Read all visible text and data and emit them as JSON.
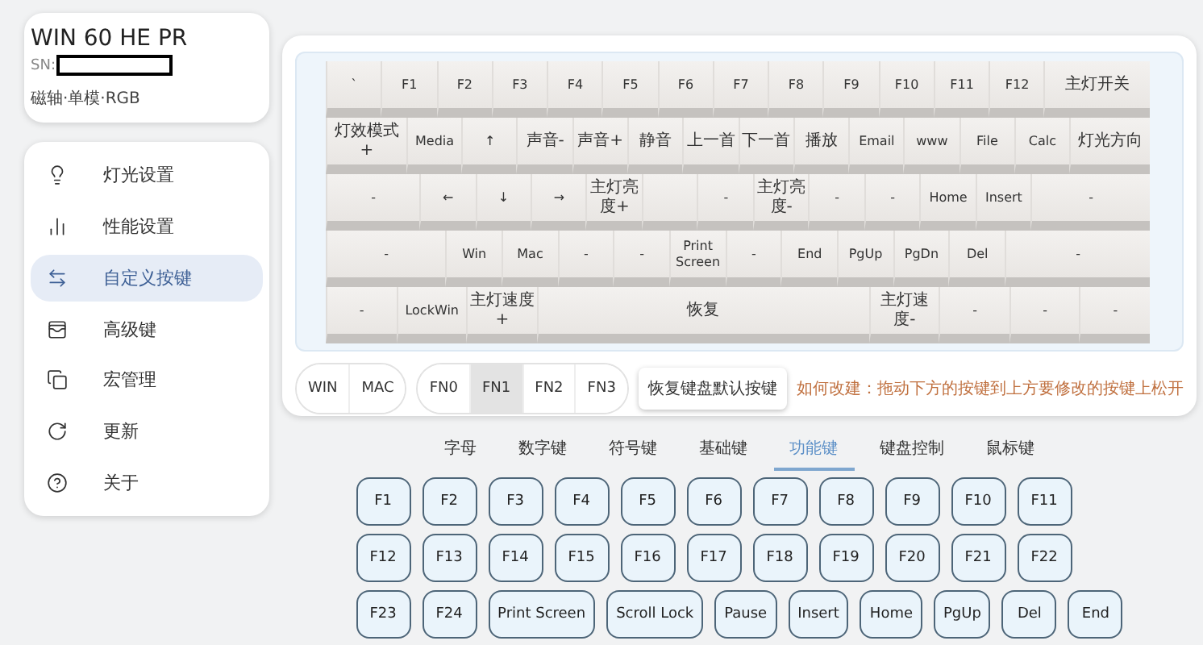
{
  "device": {
    "name": "WIN 60 HE PR",
    "sn_label": "SN:",
    "sn_redacted": true,
    "spec": "磁轴·单模·RGB"
  },
  "sidebar": {
    "items": [
      {
        "label": "灯光设置",
        "selected": false
      },
      {
        "label": "性能设置",
        "selected": false
      },
      {
        "label": "自定义按键",
        "selected": true
      },
      {
        "label": "高级键",
        "selected": false
      },
      {
        "label": "宏管理",
        "selected": false
      },
      {
        "label": "更新",
        "selected": false
      },
      {
        "label": "关于",
        "selected": false
      }
    ]
  },
  "keyboard": {
    "rows": [
      {
        "keys": [
          "`",
          "F1",
          "F2",
          "F3",
          "F4",
          "F5",
          "F6",
          "F7",
          "F8",
          "F9",
          "F10",
          "F11",
          "F12",
          "主灯开关"
        ]
      },
      {
        "keys": [
          "灯效模式+",
          "Media",
          "↑",
          "声音-",
          "声音+",
          "静音",
          "上一首",
          "下一首",
          "播放",
          "Email",
          "www",
          "File",
          "Calc",
          "灯光方向"
        ]
      },
      {
        "keys": [
          "-",
          "←",
          "↓",
          "→",
          "主灯亮度+",
          "-",
          "主灯亮度-",
          "-",
          "-",
          "Home",
          "Insert",
          "-"
        ]
      },
      {
        "keys": [
          "-",
          "Win",
          "Mac",
          "-",
          "-",
          "Print Screen",
          "-",
          "End",
          "PgUp",
          "PgDn",
          "Del",
          "-"
        ]
      },
      {
        "keys": [
          "-",
          "LockWin",
          "主灯速度+",
          "恢复",
          "主灯速度-",
          "-",
          "-",
          "-"
        ]
      }
    ]
  },
  "os_toggle": [
    {
      "label": "WIN",
      "selected": false
    },
    {
      "label": "MAC",
      "selected": false
    }
  ],
  "layers": [
    {
      "label": "FN0",
      "selected": false
    },
    {
      "label": "FN1",
      "selected": true
    },
    {
      "label": "FN2",
      "selected": false
    },
    {
      "label": "FN3",
      "selected": false
    }
  ],
  "reset_button": "恢复键盘默认按键",
  "hint": "如何改建：拖动下方的按键到上方要修改的按键上松开",
  "categories": [
    {
      "label": "字母",
      "selected": false
    },
    {
      "label": "数字键",
      "selected": false
    },
    {
      "label": "符号键",
      "selected": false
    },
    {
      "label": "基础键",
      "selected": false
    },
    {
      "label": "功能键",
      "selected": true
    },
    {
      "label": "键盘控制",
      "selected": false
    },
    {
      "label": "鼠标键",
      "selected": false
    }
  ],
  "palette": [
    [
      "F1",
      "F2",
      "F3",
      "F4",
      "F5",
      "F6",
      "F7",
      "F8",
      "F9",
      "F10",
      "F11"
    ],
    [
      "F12",
      "F13",
      "F14",
      "F15",
      "F16",
      "F17",
      "F18",
      "F19",
      "F20",
      "F21",
      "F22"
    ],
    [
      "F23",
      "F24",
      "Print Screen",
      "Scroll Lock",
      "Pause",
      "Insert",
      "Home",
      "PgUp",
      "Del",
      "End"
    ]
  ]
}
